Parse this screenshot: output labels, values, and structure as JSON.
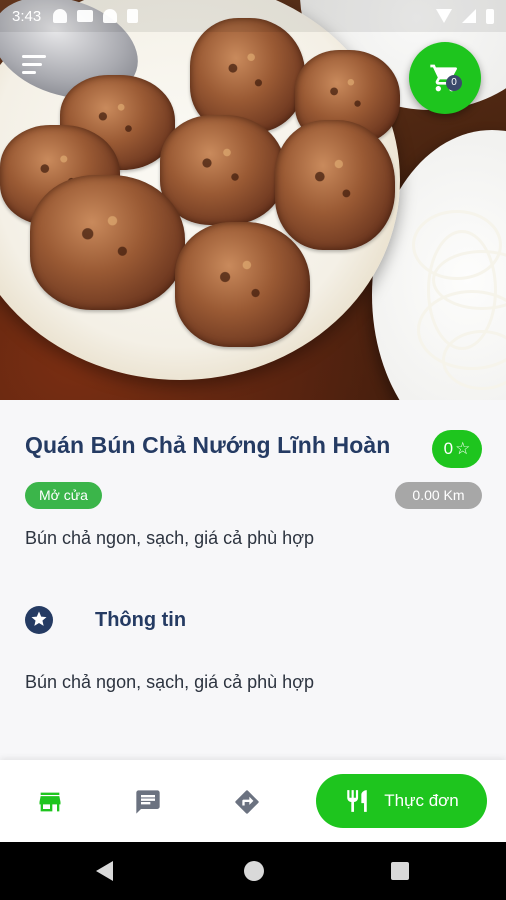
{
  "status_bar": {
    "time": "3:43"
  },
  "hero": {
    "cart_count": "0"
  },
  "restaurant": {
    "name": "Quán Bún Chả Nướng Lĩnh Hoàn",
    "rating": "0",
    "rating_star": "☆",
    "status": "Mở cửa",
    "distance": "0.00 Km",
    "short_description": "Bún chả ngon, sạch, giá cả phù hợp"
  },
  "info_section": {
    "title": "Thông tin",
    "description": "Bún chả ngon, sạch, giá cả phù hợp"
  },
  "bottom_bar": {
    "menu_label": "Thực đơn"
  },
  "colors": {
    "accent_green": "#1ec51e",
    "open_green": "#3bb54a",
    "navy": "#253b63",
    "distance_gray": "#a7a7a7"
  },
  "icons": {
    "cart": "cart-icon",
    "menu": "hamburger-icon",
    "store": "store-icon",
    "chat": "chat-icon",
    "directions": "directions-icon",
    "cutlery": "cutlery-icon",
    "star": "star-icon"
  }
}
